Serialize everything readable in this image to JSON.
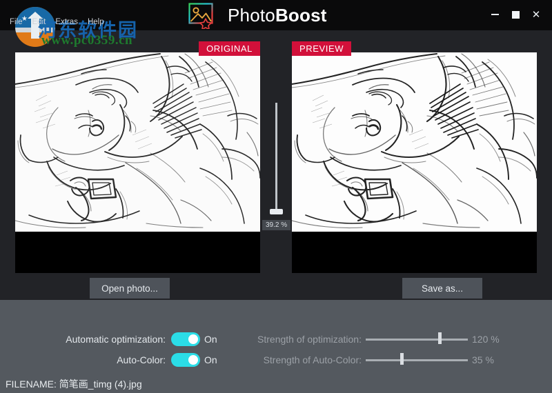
{
  "window": {
    "app_title_light": "Photo",
    "app_title_bold": "Boost",
    "logo_icon": "photo-frame-star-icon",
    "controls": {
      "minimize": "minimize-icon",
      "maximize": "maximize-icon",
      "close": "✕"
    }
  },
  "menubar": {
    "items": [
      {
        "label": "File"
      },
      {
        "label": "Edit"
      },
      {
        "label": "Extras"
      },
      {
        "label": "Help"
      }
    ]
  },
  "watermark": {
    "site_name": "河东软件园",
    "site_url": "www.pc0359.cn",
    "logo_icon": "site-badge-icon"
  },
  "panes": {
    "original": {
      "badge": "ORIGINAL",
      "button_label": "Open photo..."
    },
    "preview": {
      "badge": "PREVIEW",
      "button_label": "Save as..."
    }
  },
  "zoom_slider": {
    "value_label": "39.2 %",
    "value_percent": 39.2,
    "orientation": "vertical"
  },
  "controls": {
    "rows": [
      {
        "label": "Automatic optimization:",
        "toggle_state": "On",
        "toggle_on": true,
        "strength_label": "Strength of optimization:",
        "strength_value": "120 %",
        "strength_percent": 72,
        "disabled": true
      },
      {
        "label": "Auto-Color:",
        "toggle_state": "On",
        "toggle_on": true,
        "strength_label": "Strength of Auto-Color:",
        "strength_value": "35 %",
        "strength_percent": 35,
        "disabled": true
      }
    ],
    "filename": "FILENAME: 简笔画_timg (4).jpg"
  },
  "colors": {
    "titlebar": "#0a0a0b",
    "stage": "#222327",
    "panel": "#54595f",
    "badge_red": "#d2103a",
    "toggle_cyan": "#2bdde7",
    "button_gray": "#4e535a",
    "text_light": "#e4e8ec",
    "text_muted": "#9ba0a6"
  }
}
